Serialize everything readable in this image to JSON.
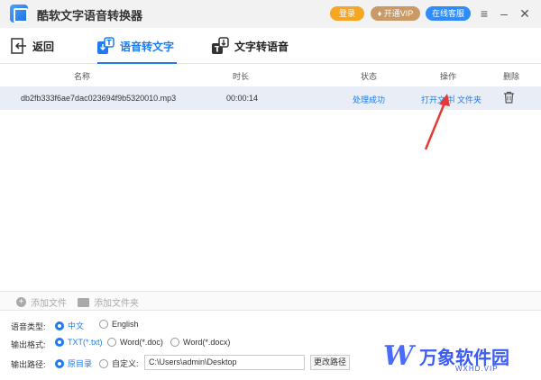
{
  "app": {
    "title": "酷软文字语音转换器",
    "login_label": "登录",
    "vip_label": "开通VIP",
    "service_label": "在线客服",
    "window_controls": [
      "menu-icon",
      "minimize-icon",
      "close-icon"
    ]
  },
  "nav": {
    "back_label": "返回",
    "tabs": [
      {
        "label": "语音转文字",
        "active": true
      },
      {
        "label": "文字转语音",
        "active": false
      }
    ]
  },
  "table": {
    "columns": [
      "名称",
      "时长",
      "状态",
      "操作",
      "删除"
    ],
    "rows": [
      {
        "filename": "db2fb333f6ae7dac023694f9b5320010.mp3",
        "duration": "00:00:14",
        "status": "处理成功",
        "open_file": "打开文件",
        "separator": "|",
        "folder": "文件夹"
      }
    ]
  },
  "add_bar": {
    "add_file": "添加文件",
    "add_folder": "添加文件夹"
  },
  "options": {
    "language": {
      "label": "语音类型:",
      "choices": [
        "中文",
        "English"
      ],
      "selected": "中文"
    },
    "format": {
      "label": "输出格式:",
      "choices": [
        "TXT(*.txt)",
        "Word(*.doc)",
        "Word(*.docx)"
      ],
      "selected": "TXT(*.txt)"
    },
    "path": {
      "label": "输出路径:",
      "choices": [
        "原目录",
        "自定义:"
      ],
      "selected": "原目录",
      "value": "C:\\Users\\admin\\Desktop",
      "change_label": "更改路径"
    }
  },
  "brand": {
    "logo_mark": "W",
    "name": "万象软件园",
    "url": "WXHD.VIP"
  },
  "colors": {
    "accent": "#1e7bf0",
    "login": "#f5a623",
    "vip": "#c99a66",
    "service": "#2f8cff",
    "row_bg": "#e9eef6",
    "arrow": "#e53935"
  }
}
